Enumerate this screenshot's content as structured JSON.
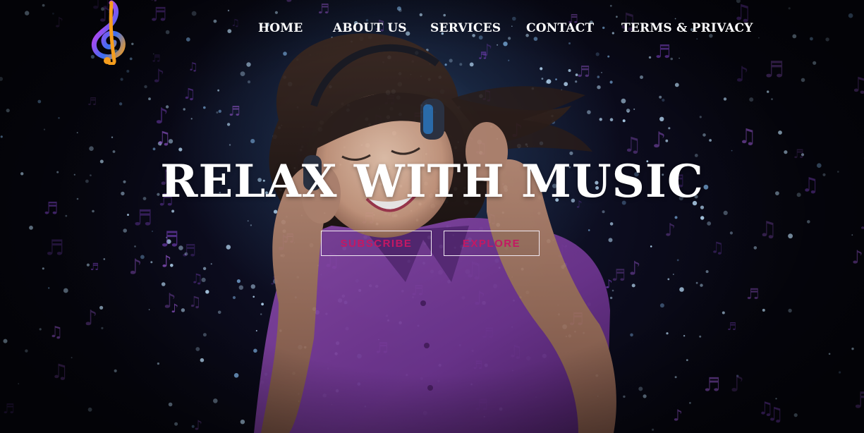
{
  "brand": {
    "logo_icon": "treble-clef-icon",
    "logo_colors": [
      "#e93ba4",
      "#f59d1d",
      "#3b6ff2",
      "#a24bf0"
    ]
  },
  "nav": {
    "items": [
      {
        "label": "HOME"
      },
      {
        "label": "ABOUT US"
      },
      {
        "label": "SERVICES"
      },
      {
        "label": "CONTACT"
      },
      {
        "label": "TERMS & PRIVACY"
      }
    ]
  },
  "hero": {
    "headline": "RELAX WITH MUSIC",
    "background_image": "woman-with-headphones-photo",
    "buttons": {
      "subscribe_label": "SUBSCRIBE",
      "explore_label": "EXPLORE"
    }
  },
  "colors": {
    "nav_text": "#ffffff",
    "headline": "#ffffff",
    "button_text": "#c41863",
    "button_border": "#f1e9f2",
    "shirt_purple": "#7b3f9b",
    "note_purple": "#7a42c2"
  }
}
